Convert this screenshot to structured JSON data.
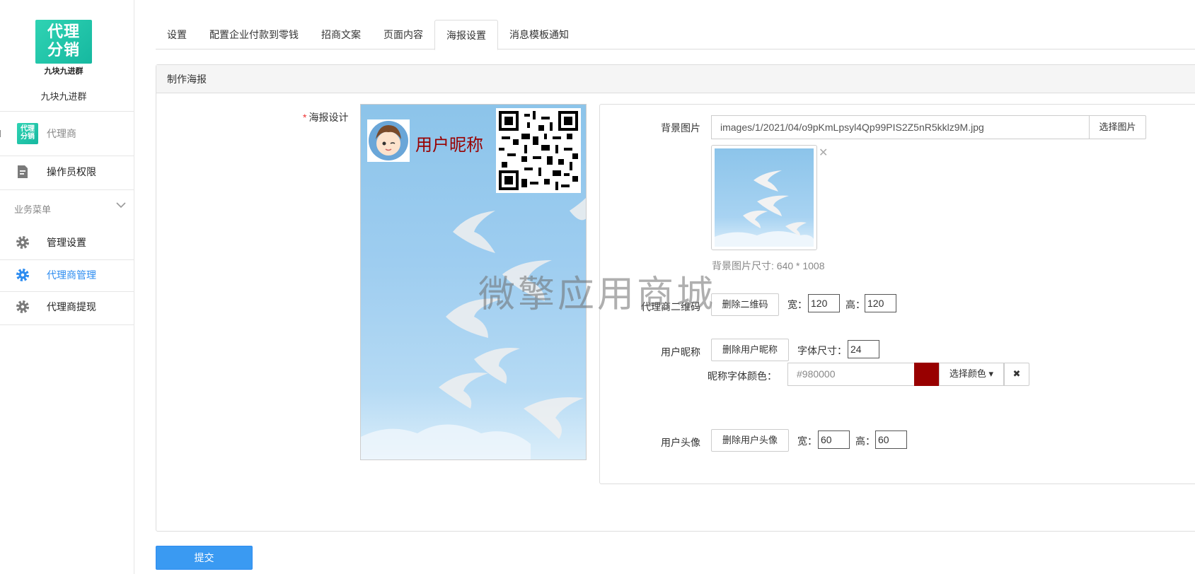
{
  "sidebar": {
    "logo_text_line1": "代理",
    "logo_text_line2": "分销",
    "logo_caption": "九块九进群",
    "shop_name": "九块九进群",
    "app_row": {
      "mini_logo_line1": "代理",
      "mini_logo_line2": "分销",
      "label": "代理商"
    },
    "operator_label": "操作员权限",
    "group_title": "业务菜单",
    "items": [
      {
        "label": "管理设置",
        "icon": "gear-icon",
        "active": false
      },
      {
        "label": "代理商管理",
        "icon": "gear-icon",
        "active": true
      },
      {
        "label": "代理商提现",
        "icon": "gear-icon",
        "active": false
      }
    ]
  },
  "tabs": [
    "设置",
    "配置企业付款到零钱",
    "招商文案",
    "页面内容",
    "海报设置",
    "消息模板通知"
  ],
  "active_tab": "海报设置",
  "panel": {
    "title": "制作海报",
    "poster_label": "海报设计",
    "poster_nick": "用户昵称"
  },
  "config": {
    "bg_label": "背景图片",
    "bg_value": "images/1/2021/04/o9pKmLpsyl4Qp99PIS2Z5nR5kklz9M.jpg",
    "bg_button": "选择图片",
    "bg_hint": "背景图片尺寸: 640 * 1008",
    "qr_label": "代理商二维码",
    "qr_delete": "删除二维码",
    "qr_w_label": "宽：",
    "qr_w": "120",
    "qr_h_label": "高：",
    "qr_h": "120",
    "nick_label": "用户昵称",
    "nick_delete": "删除用户昵称",
    "font_size_label": "字体尺寸：",
    "font_size": "24",
    "color_label": "昵称字体颜色：",
    "color_value": "#980000",
    "color_button": "选择颜色",
    "avatar_label": "用户头像",
    "avatar_delete": "删除用户头像",
    "av_w_label": "宽：",
    "av_w": "60",
    "av_h_label": "高：",
    "av_h": "60"
  },
  "watermark": "微擎应用商城",
  "submit_label": "提交",
  "colors": {
    "accent": "#2d8cf0",
    "nick_color": "#980000",
    "logo": "#1fc5a8"
  }
}
